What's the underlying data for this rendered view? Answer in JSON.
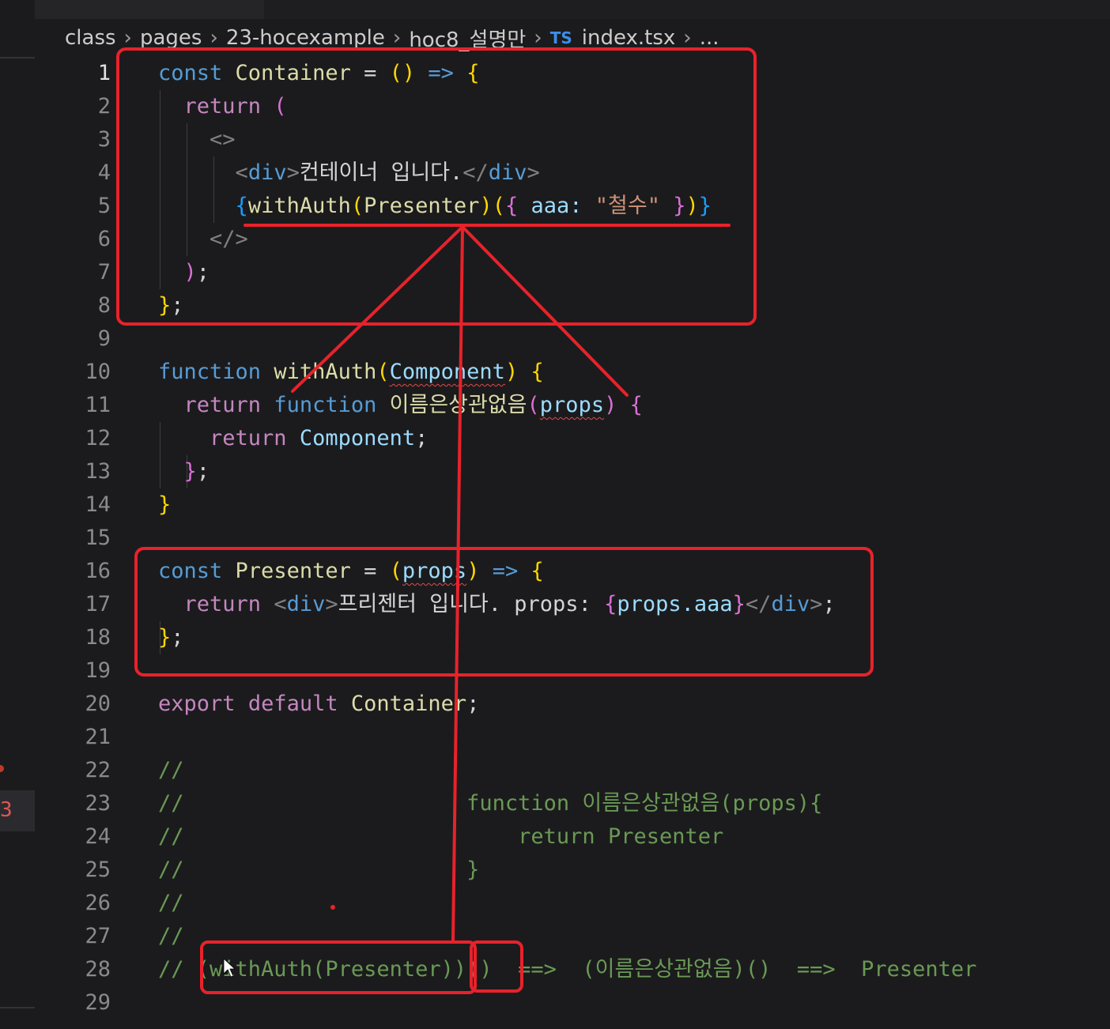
{
  "breadcrumb": {
    "items": [
      "class",
      "pages",
      "23-hocexample",
      "hoc8_설명만"
    ],
    "file_type_badge": "TS",
    "file": "index.tsx",
    "more": "..."
  },
  "line_numbers": [
    "1",
    "2",
    "3",
    "4",
    "5",
    "6",
    "7",
    "8",
    "9",
    "10",
    "11",
    "12",
    "13",
    "14",
    "15",
    "16",
    "17",
    "18",
    "19",
    "20",
    "21",
    "22",
    "23",
    "24",
    "25",
    "26",
    "27",
    "28",
    "29"
  ],
  "code": {
    "l1": {
      "kw_const": "const",
      "name": "Container",
      "eq": " = ",
      "parens": "()",
      "arrow": " => ",
      "brace": "{"
    },
    "l2": {
      "ret": "return",
      "paren": "("
    },
    "l3": {
      "frag_open": "<>"
    },
    "l4": {
      "lt": "<",
      "tag": "div",
      "gt": ">",
      "text": "컨테이너 입니다.",
      "close_lt": "</",
      "close_tag": "div",
      "close_gt": ">"
    },
    "l5": {
      "brace_open": "{",
      "fn": "withAuth",
      "p_open": "(",
      "arg": "Presenter",
      "p_close": ")",
      "call_open": "(",
      "obj_open": "{ ",
      "key": "aaa",
      "colon": ": ",
      "val": "\"철수\"",
      "obj_close": " }",
      "call_close": ")",
      "brace_close": "}"
    },
    "l6": {
      "frag_close": "</>"
    },
    "l7": {
      "paren": ")",
      "semi": ";"
    },
    "l8": {
      "brace": "}",
      "semi": ";"
    },
    "l10": {
      "kw": "function",
      "fn": "withAuth",
      "p_open": "(",
      "param": "Component",
      "p_close": ")",
      "brace": "{"
    },
    "l11": {
      "ret": "return",
      "kw": "function",
      "fn": "이름은상관없음",
      "p_open": "(",
      "param": "props",
      "p_close": ")",
      "brace": "{"
    },
    "l12": {
      "ret": "return",
      "value": "Component",
      "semi": ";"
    },
    "l13": {
      "brace": "}",
      "semi": ";"
    },
    "l14": {
      "brace": "}"
    },
    "l16": {
      "kw_const": "const",
      "name": "Presenter",
      "eq": " = ",
      "p_open": "(",
      "param": "props",
      "p_close": ")",
      "arrow": " => ",
      "brace": "{"
    },
    "l17": {
      "ret": "return",
      "lt": "<",
      "tag": "div",
      "gt": ">",
      "text": "프리젠터 입니다. props: ",
      "ex_open": "{",
      "expr": "props.aaa",
      "ex_close": "}",
      "close_lt": "</",
      "close_tag": "div",
      "close_gt": ">",
      "semi": ";"
    },
    "l18": {
      "brace": "}",
      "semi": ";"
    },
    "l20": {
      "export": "export",
      "default": "default",
      "name": "Container",
      "semi": ";"
    },
    "l22": "//",
    "l23": "//                      function 이름은상관없음(props){",
    "l24": "//                          return Presenter",
    "l25": "//                      }",
    "l26": "//",
    "l27": "//",
    "l28": "// (withAuth(Presenter))()  ==>  (이름은상관없음)()  ==>  Presenter"
  },
  "colors": {
    "annotation_red": "#e8222b",
    "background": "#1b1b1d",
    "keyword": "#569cd6",
    "control": "#c586c0",
    "function": "#dcdcaa",
    "comment": "#6a9955"
  }
}
